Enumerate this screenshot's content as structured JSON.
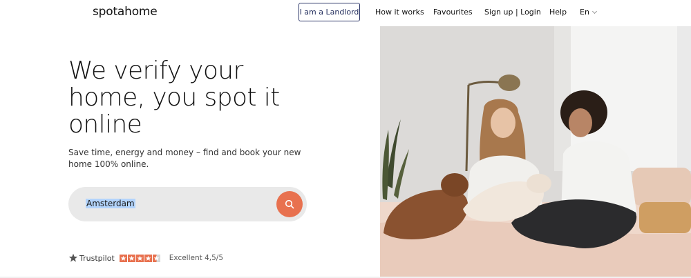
{
  "header": {
    "logo": "spotahome",
    "landlord_button": "I am a Landlord",
    "nav": {
      "how_it_works": "How it works",
      "favourites": "Favourites",
      "signup_login": "Sign up | Login",
      "help": "Help",
      "language": "En"
    }
  },
  "hero": {
    "title": "We verify your home, you spot it online",
    "subtitle": "Save time, energy and money – find and book your new home 100% online.",
    "search": {
      "value": "Amsterdam"
    }
  },
  "trustpilot": {
    "name": "Trustpilot",
    "rating_text": "Excellent 4,5/5",
    "stars": 4.5,
    "color": "#e8714f"
  },
  "colors": {
    "accent": "#e8714f",
    "landlord_border": "#2a3467"
  },
  "icons": {
    "search": "search-icon",
    "chevron": "chevron-down-icon",
    "trustpilot": "trustpilot-star-icon",
    "photo": "hero-photo"
  }
}
